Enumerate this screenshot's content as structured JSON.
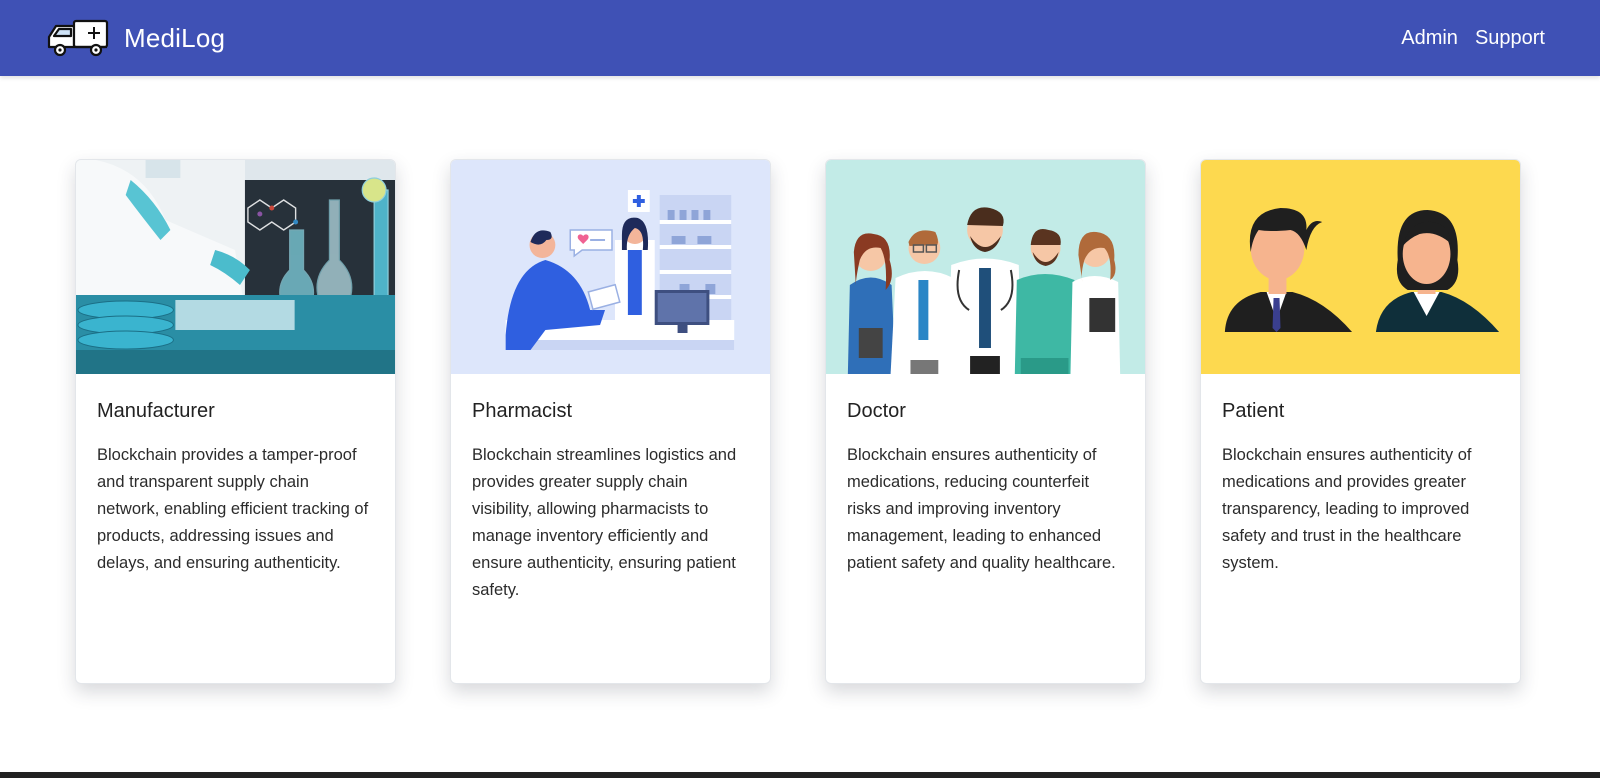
{
  "header": {
    "brand_name": "MediLog",
    "logo_icon": "ambulance-icon",
    "links": [
      {
        "label": "Admin"
      },
      {
        "label": "Support"
      }
    ]
  },
  "cards": [
    {
      "title": "Manufacturer",
      "image": "laboratory-scientist-image",
      "text": "Blockchain provides a tamper-proof and transparent supply chain network, enabling efficient tracking of products, addressing issues and delays, and ensuring authenticity."
    },
    {
      "title": "Pharmacist",
      "image": "pharmacy-counter-image",
      "text": "Blockchain streamlines logistics and provides greater supply chain visibility, allowing pharmacists to manage inventory efficiently and ensure authenticity, ensuring patient safety."
    },
    {
      "title": "Doctor",
      "image": "doctors-group-image",
      "text": "Blockchain ensures authenticity of medications, reducing counterfeit risks and improving inventory management, leading to enhanced patient safety and quality healthcare."
    },
    {
      "title": "Patient",
      "image": "patients-avatars-image",
      "text": "Blockchain ensures authenticity of medications and provides greater transparency, leading to improved safety and trust in the healthcare system."
    }
  ],
  "colors": {
    "navbar": "#3f51b5",
    "card_bg_pharmacist": "#dde6fb",
    "card_bg_doctor": "#c2ebe7",
    "card_bg_patient": "#fdd94f",
    "footer": "#212121"
  }
}
